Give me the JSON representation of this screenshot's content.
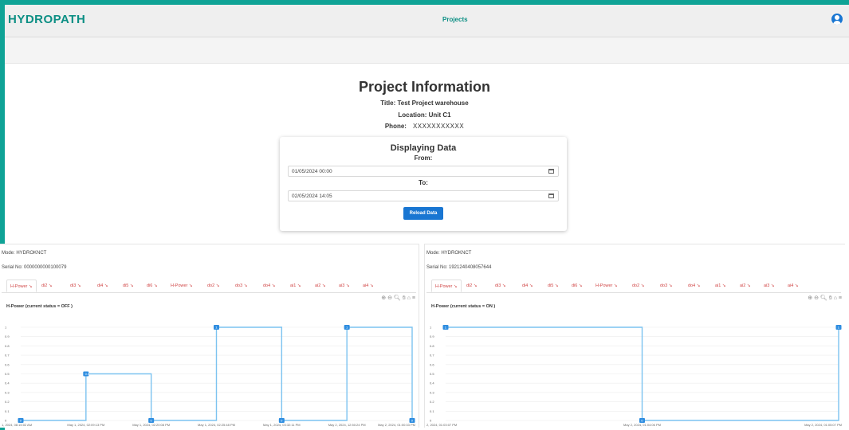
{
  "header": {
    "brand": "HYDROPATH",
    "nav_projects": "Projects"
  },
  "project": {
    "heading": "Project Information",
    "title_line": "Title: Test Project warehouse",
    "location_line": "Location: Unit C1",
    "phone_label": "Phone:",
    "phone_value": "XXXXXXXXXXX"
  },
  "display_panel": {
    "title": "Displaying Data",
    "from_label": "From:",
    "from_value": "01/05/2024 00:00",
    "to_label": "To:",
    "to_value": "02/05/2024 14:05",
    "reload_button": "Reload Data"
  },
  "chart_data": [
    {
      "type": "line",
      "mode_label": "Mode: HYDROKNCT",
      "serial_label": "Serial No: 0000000000100079",
      "tabs": [
        "H-Power",
        "di2",
        "di3",
        "di4",
        "di5",
        "di6",
        "H-Power",
        "do2",
        "do3",
        "do4",
        "ai1",
        "ai2",
        "ai3",
        "ai4"
      ],
      "title": "H-Power (current status = OFF )",
      "y_ticks": [
        "1",
        "0.9",
        "0.8",
        "0.7",
        "0.6",
        "0.5",
        "0.4",
        "0.3",
        "0.2",
        "0.1",
        "0"
      ],
      "ylim": [
        0,
        1
      ],
      "step": "after",
      "x": [
        "1, 2024, 08:15:02 AM",
        "May 1, 2024, 02:09:13 PM",
        "May 1, 2024, 02:20:08 PM",
        "May 1, 2024, 02:25:48 PM",
        "May 1, 2024, 03:32:11 PM",
        "May 2, 2024, 12:50:24 PM",
        "May 2, 2024, 01:00:33 PM"
      ],
      "series": [
        {
          "values": [
            0,
            0.5,
            0,
            1,
            0,
            1,
            0
          ]
        }
      ]
    },
    {
      "type": "line",
      "mode_label": "Mode: HYDROKNCT",
      "serial_label": "Serial No: 1921240408057644",
      "tabs": [
        "H-Power",
        "di2",
        "di3",
        "di4",
        "di5",
        "di6",
        "H-Power",
        "do2",
        "do3",
        "do4",
        "ai1",
        "ai2",
        "ai3",
        "ai4"
      ],
      "title": "H-Power (current status = ON )",
      "y_ticks": [
        "1",
        "0.9",
        "0.8",
        "0.7",
        "0.6",
        "0.5",
        "0.4",
        "0.3",
        "0.2",
        "0.1",
        "0"
      ],
      "ylim": [
        0,
        1
      ],
      "step": "after",
      "x": [
        "2, 2024, 01:03:07 PM",
        "May 2, 2024, 01:04:06 PM",
        "May 2, 2024, 01:05:07 PM"
      ],
      "series": [
        {
          "values": [
            1,
            0,
            1
          ]
        }
      ]
    }
  ],
  "colors": {
    "frame": "#0fa396",
    "brand": "#0c8f84",
    "button": "#1976d2",
    "series": "#7cc3f0",
    "marker": "#2e8de0",
    "tab_text": "#d04545"
  },
  "icons": {
    "user": "user-circle-icon",
    "calendar": "calendar-icon",
    "toolbar": [
      "zoom-in-icon",
      "zoom-out-icon",
      "magnifier-icon",
      "pan-icon",
      "home-icon",
      "menu-icon"
    ]
  }
}
